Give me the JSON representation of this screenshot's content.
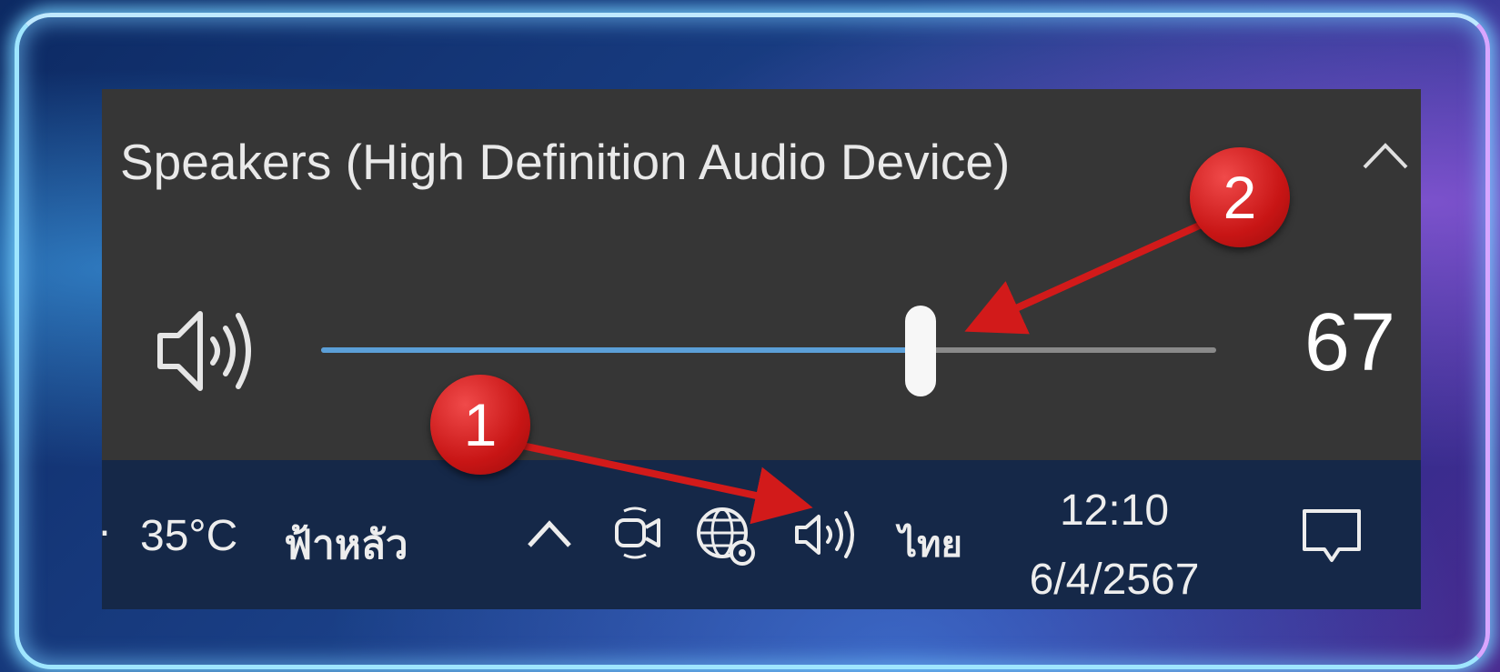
{
  "flyout": {
    "device_name": "Speakers (High Definition Audio Device)",
    "volume_value": "67",
    "volume_level_percent": 67
  },
  "taskbar": {
    "weather_temp": "35°C",
    "weather_desc": "ฟ้าหลัว",
    "language": "ไทย",
    "time": "12:10",
    "date": "6/4/2567",
    "icons": [
      "chevron-up-icon",
      "meet-now-icon",
      "globe-network-icon",
      "speaker-icon",
      "action-center-icon"
    ]
  },
  "annotations": {
    "step1": "1",
    "step2": "2",
    "color": "#d21a1a"
  }
}
